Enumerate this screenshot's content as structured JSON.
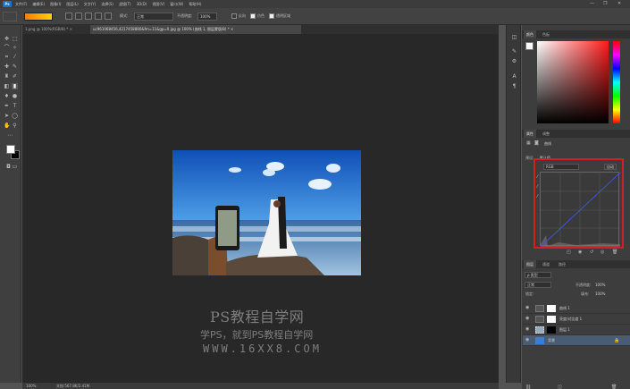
{
  "menubar": {
    "logo": "Ps",
    "items": [
      "文件(F)",
      "编辑(E)",
      "图像(I)",
      "图层(L)",
      "文字(Y)",
      "选择(S)",
      "滤镜(T)",
      "3D(D)",
      "视图(V)",
      "窗口(W)",
      "帮助(H)"
    ],
    "controls": [
      "—",
      "❐",
      "✕"
    ]
  },
  "options": {
    "mode_label": "模式:",
    "mode_value": "正常",
    "opacity_label": "不透明度:",
    "opacity_value": "100%",
    "reverse_label": "反向",
    "dither_label": "仿色",
    "transparency_label": "透明区域"
  },
  "tabs": [
    {
      "label": "1.png @ 100%(RGB/8) *  ×"
    },
    {
      "label": "uc961068456,4217458880&fm=11&gp=0.jpg @ 100% (曲线 1, 图层蒙版/8) * ×"
    }
  ],
  "watermark": {
    "line1": "PS教程自学网",
    "line2": "学PS，就到PS教程自学网",
    "line3": "WWW.16XX8.COM"
  },
  "statusbar": {
    "zoom": "100%",
    "doc": "文档:567.8K/2.41M"
  },
  "color_panel": {
    "tabs": [
      "颜色",
      "色板"
    ]
  },
  "properties_panel": {
    "tabs": [
      "属性",
      "调整"
    ],
    "title": "曲线",
    "preset_label": "预设:",
    "preset_value": "默认值",
    "channel_value": "RGB",
    "auto_label": "自动"
  },
  "layers_panel": {
    "tabs": [
      "图层",
      "通道",
      "路径"
    ],
    "kind_label": "ρ 类型",
    "blend_mode": "正常",
    "opacity_label": "不透明度:",
    "opacity_value": "100%",
    "lock_label": "锁定:",
    "fill_label": "填充:",
    "fill_value": "100%",
    "layers": [
      {
        "name": "曲线 1"
      },
      {
        "name": "亮度/对比度 1"
      },
      {
        "name": "图层 1"
      },
      {
        "name": "背景"
      }
    ]
  },
  "colors": {
    "accent_red": "#d21f1f",
    "bg": "#535353",
    "canvas": "#282828"
  }
}
